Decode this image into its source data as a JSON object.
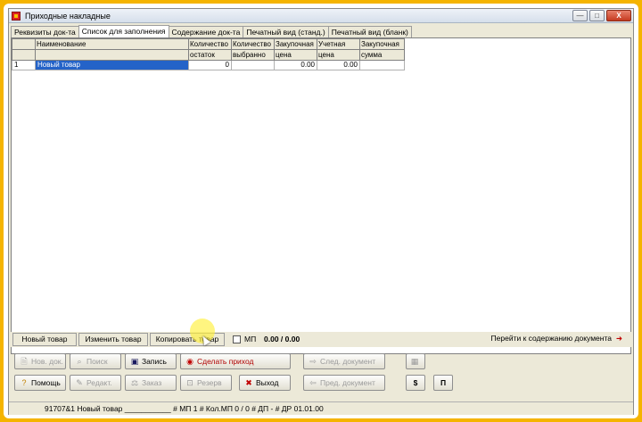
{
  "window": {
    "title": "Приходные накладные",
    "buttons": {
      "minimize": "—",
      "maximize": "□",
      "close": "X"
    }
  },
  "tabs": [
    {
      "label": "Реквизиты док-та"
    },
    {
      "label": "Список для заполнения"
    },
    {
      "label": "Содержание док-та"
    },
    {
      "label": "Печатный вид (станд.)"
    },
    {
      "label": "Печатный вид (бланк)"
    }
  ],
  "grid": {
    "headers": [
      [
        "",
        ""
      ],
      [
        "Наименование",
        ""
      ],
      [
        "Количество",
        "остаток"
      ],
      [
        "Количество",
        "выбранно"
      ],
      [
        "Закупочная",
        "цена"
      ],
      [
        "Учетная",
        "цена"
      ],
      [
        "Закупочная",
        "сумма"
      ]
    ],
    "rows": [
      {
        "num": "1",
        "name": "Новый товар",
        "stock": "0",
        "selected": "",
        "purchase_price": "0.00",
        "account_price": "0.00",
        "purchase_sum": ""
      }
    ]
  },
  "bottombar": {
    "new_item": "Новый товар",
    "edit_item": "Изменить товар",
    "copy_item": "Копировать товар",
    "mp_label": "МП",
    "mp_value": "0.00 / 0.00",
    "goto_content": "Перейти к содержанию документа"
  },
  "toolbar": {
    "new_doc": "Нов. док.",
    "search": "Поиск",
    "save": "Запись",
    "make_receipt": "Сделать приход",
    "next_doc": "След. документ",
    "help": "Помощь",
    "edit": "Редакт.",
    "order": "Заказ",
    "reserve": "Резерв",
    "exit": "Выход",
    "prev_doc": "Пред. документ",
    "dollar": "$",
    "p": "П"
  },
  "status": {
    "text": "91707&1 Новый товар ___________ # МП 1 # Кол.МП  0 /  0 # ДП -   # ДР 01.01.00"
  },
  "colors": {
    "accent_frame": "#f5b400",
    "selection": "#2463c8",
    "receipt_text": "#b00000"
  }
}
